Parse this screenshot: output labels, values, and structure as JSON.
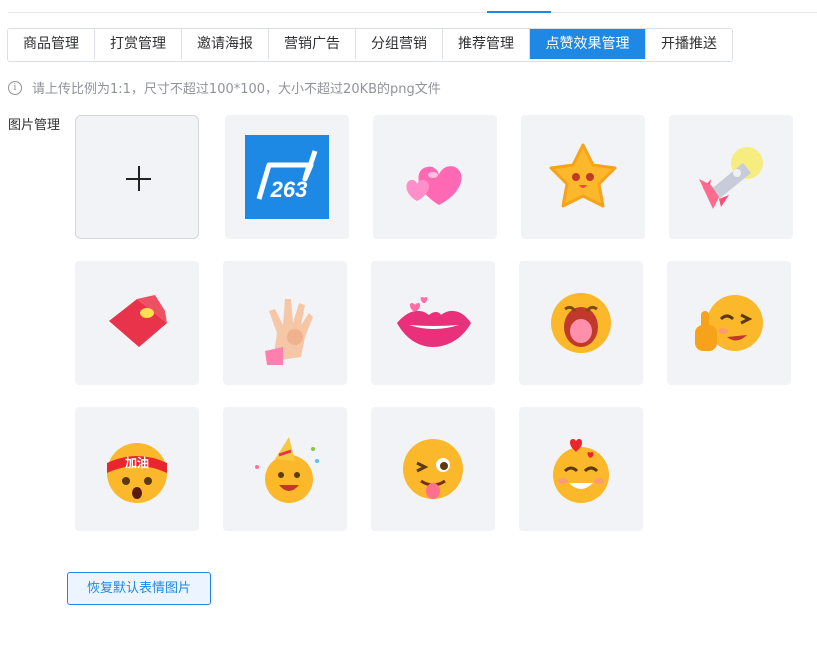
{
  "tabs": [
    {
      "label": "商品管理",
      "active": false
    },
    {
      "label": "打赏管理",
      "active": false
    },
    {
      "label": "邀请海报",
      "active": false
    },
    {
      "label": "营销广告",
      "active": false
    },
    {
      "label": "分组营销",
      "active": false
    },
    {
      "label": "推荐管理",
      "active": false
    },
    {
      "label": "点赞效果管理",
      "active": true
    },
    {
      "label": "开播推送",
      "active": false
    }
  ],
  "hint": {
    "icon": "info-icon",
    "text": "请上传比例为1:1，尺寸不超过100*100，大小不超过20KB的png文件"
  },
  "section_label": "图片管理",
  "upload": {
    "icon": "plus-icon"
  },
  "images": [
    {
      "name": "logo-263",
      "logo_text": "263"
    },
    {
      "name": "hearts"
    },
    {
      "name": "star"
    },
    {
      "name": "rocket"
    },
    {
      "name": "wallet"
    },
    {
      "name": "ok-hand"
    },
    {
      "name": "lips"
    },
    {
      "name": "shout-face"
    },
    {
      "name": "wink-thumb"
    },
    {
      "name": "jiayou-face",
      "headband_text": "加油"
    },
    {
      "name": "party-face"
    },
    {
      "name": "tongue-wink"
    },
    {
      "name": "love-face"
    }
  ],
  "restore_button": "恢复默认表情图片",
  "colors": {
    "accent": "#1e88e5",
    "tile_bg": "#f2f3f6",
    "emoji_yellow": "#fbb82a"
  }
}
